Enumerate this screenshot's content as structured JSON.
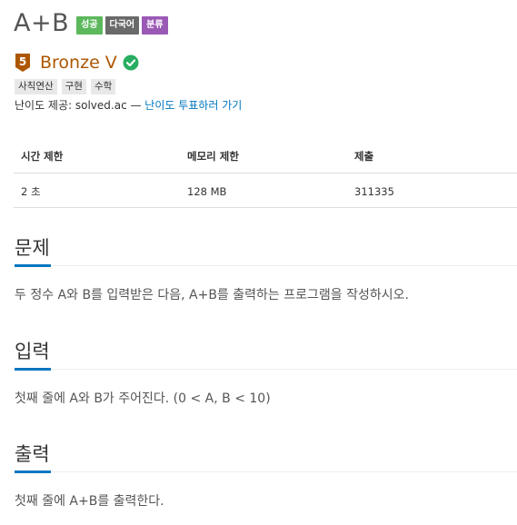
{
  "problem": {
    "title": "A+B",
    "badges": [
      {
        "label": "성공",
        "color": "#5cb85c"
      },
      {
        "label": "다국어",
        "color": "#6a6a6a"
      },
      {
        "label": "분류",
        "color": "#9b59b6"
      }
    ],
    "tier": {
      "level": "5",
      "name": "Bronze V",
      "color": "#ad5600",
      "icon": "bronze-tier-icon"
    },
    "solved_status_icon": "check-circle-icon",
    "tags": [
      "사칙연산",
      "구현",
      "수학"
    ],
    "provider": {
      "label": "난이도 제공: solved.ac — ",
      "link": "난이도 투표하러 가기"
    }
  },
  "info_table": {
    "headers": [
      "시간 제한",
      "메모리 제한",
      "제출"
    ],
    "values": [
      "2 초",
      "128 MB",
      "311335"
    ]
  },
  "sections": {
    "description": {
      "title": "문제",
      "text": "두 정수 A와 B를 입력받은 다음, A+B를 출력하는 프로그램을 작성하시오."
    },
    "input": {
      "title": "입력",
      "text": "첫째 줄에 A와 B가 주어진다. (0 < A, B < 10)"
    },
    "output": {
      "title": "출력",
      "text": "첫째 줄에 A+B를 출력한다."
    }
  },
  "colors": {
    "accent": "#0076c0",
    "bronze": "#ad5600",
    "success": "#5cb85c"
  }
}
